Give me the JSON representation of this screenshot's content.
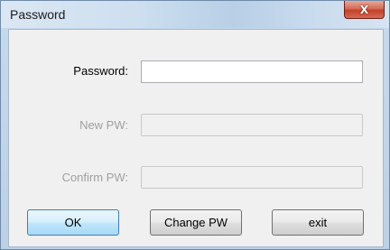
{
  "window": {
    "title": "Password",
    "close_symbol": "X"
  },
  "form": {
    "password_label": "Password:",
    "new_pw_label": "New PW:",
    "confirm_pw_label": "Confirm PW:",
    "password_value": "",
    "new_pw_value": "",
    "confirm_pw_value": ""
  },
  "buttons": {
    "ok_label": "OK",
    "change_pw_label": "Change PW",
    "exit_label": "exit"
  }
}
